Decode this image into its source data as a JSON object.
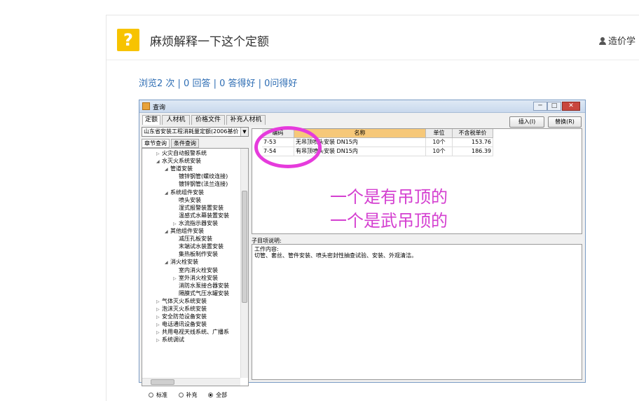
{
  "question": {
    "title": "麻烦解释一下这个定额",
    "user": "造价学",
    "stats": "浏览2 次 | 0 回答 | 0 答得好 | 0问得好"
  },
  "window": {
    "title": "查询",
    "controls": [
      "─",
      "□",
      "✕"
    ],
    "tabs": [
      "定额",
      "人材机",
      "价格文件",
      "补充人材机"
    ],
    "insert_button": "插入(I)",
    "replace_button": "替换(R)",
    "combo_value": "山东省安装工程消耗量定额(2006基价",
    "subtabs": [
      "章节查询",
      "条件查询"
    ],
    "tree": [
      {
        "label": "火灾自动报警系统",
        "arrow": "▷",
        "level": 0
      },
      {
        "label": "水灭火系统安装",
        "arrow": "◢",
        "level": 0
      },
      {
        "label": "管道安装",
        "arrow": "◢",
        "level": 1
      },
      {
        "label": "镀锌钢管(螺纹连接)",
        "arrow": "",
        "level": 2
      },
      {
        "label": "镀锌钢管(法兰连接)",
        "arrow": "",
        "level": 2
      },
      {
        "label": "系统组件安装",
        "arrow": "◢",
        "level": 1
      },
      {
        "label": "喷头安装",
        "arrow": "",
        "level": 2
      },
      {
        "label": "湿式报警装置安装",
        "arrow": "",
        "level": 2
      },
      {
        "label": "温感式水幕装置安装",
        "arrow": "",
        "level": 2
      },
      {
        "label": "水流指示器安装",
        "arrow": "▷",
        "level": 2
      },
      {
        "label": "其他组件安装",
        "arrow": "◢",
        "level": 1
      },
      {
        "label": "减压孔板安装",
        "arrow": "",
        "level": 2
      },
      {
        "label": "末端试水装置安装",
        "arrow": "",
        "level": 2
      },
      {
        "label": "集热板制作安装",
        "arrow": "",
        "level": 2
      },
      {
        "label": "消火栓安装",
        "arrow": "◢",
        "level": 1
      },
      {
        "label": "室内消火栓安装",
        "arrow": "",
        "level": 2
      },
      {
        "label": "室外消火栓安装",
        "arrow": "▷",
        "level": 2
      },
      {
        "label": "消防水泵接合器安装",
        "arrow": "",
        "level": 2
      },
      {
        "label": "隔膜式气压水罐安装",
        "arrow": "",
        "level": 2
      },
      {
        "label": "气体灭火系统安装",
        "arrow": "▷",
        "level": 0
      },
      {
        "label": "泡沫灭火系统安装",
        "arrow": "▷",
        "level": 0
      },
      {
        "label": "安全防范设备安装",
        "arrow": "▷",
        "level": 0
      },
      {
        "label": "电话通讯设备安装",
        "arrow": "▷",
        "level": 0
      },
      {
        "label": "共用电视天线系统、广播系",
        "arrow": "▷",
        "level": 0
      },
      {
        "label": "系统调试",
        "arrow": "▷",
        "level": 0
      }
    ],
    "radios": [
      {
        "label": "标准",
        "checked": false
      },
      {
        "label": "补充",
        "checked": false
      },
      {
        "label": "全部",
        "checked": true
      }
    ],
    "grid": {
      "headers": [
        "编码",
        "名称",
        "单位",
        "不含税单价"
      ],
      "rows": [
        [
          "7-53",
          "无吊顶喷头安装 DN15内",
          "10个",
          "153.76"
        ],
        [
          "7-54",
          "有吊顶喷头安装 DN15内",
          "10个",
          "186.39"
        ]
      ]
    },
    "desc_label": "子目项说明:",
    "desc_lines": [
      "工作内容:",
      "切管、套丝、管件安装、喷头密封性抽查试验、安装、外观清洁。"
    ]
  },
  "annotation": {
    "line1": "一个是有吊顶的",
    "line2": "一个是武吊顶的",
    "color": "#d43fd0"
  }
}
